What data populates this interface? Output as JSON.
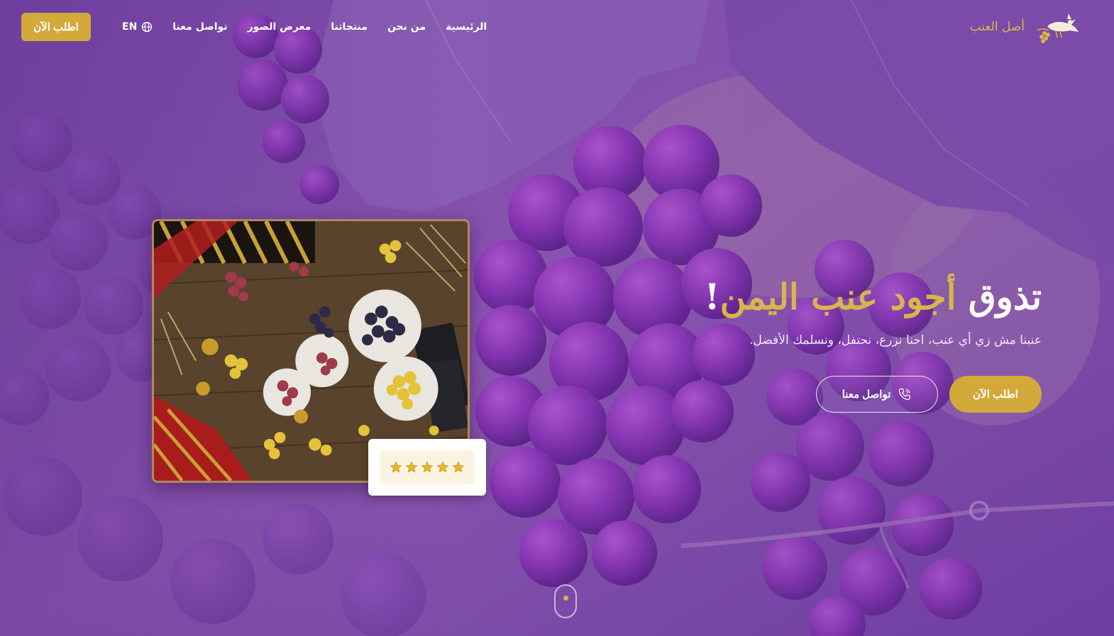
{
  "brand": {
    "name": "أصل العنب",
    "logo_icon": "bird-on-grape-icon"
  },
  "nav": {
    "items": [
      {
        "label": "الرئيسية"
      },
      {
        "label": "من نحن"
      },
      {
        "label": "منتجاتنا"
      },
      {
        "label": "معرض الصور"
      },
      {
        "label": "تواصل معنا"
      }
    ],
    "language": {
      "label": "EN",
      "icon": "globe-icon"
    },
    "order_button": "اطلب الآن"
  },
  "hero": {
    "title_white_1": "تذوق ",
    "title_gold": "أجود عنب اليمن",
    "title_white_2": "!",
    "subtitle": "عنبنا مش زي أي عنب، احنا نزرع، نحتفل، ونسلمك الأفضل.",
    "primary_button": "اطلب الآن",
    "secondary_button": "تواصل معنا",
    "secondary_icon": "phone-icon"
  },
  "rating": {
    "stars": 5,
    "icon": "star-icon"
  },
  "colors": {
    "gold": "#d3a93a",
    "purple": "#6a3aa0",
    "white": "#ffffff"
  }
}
